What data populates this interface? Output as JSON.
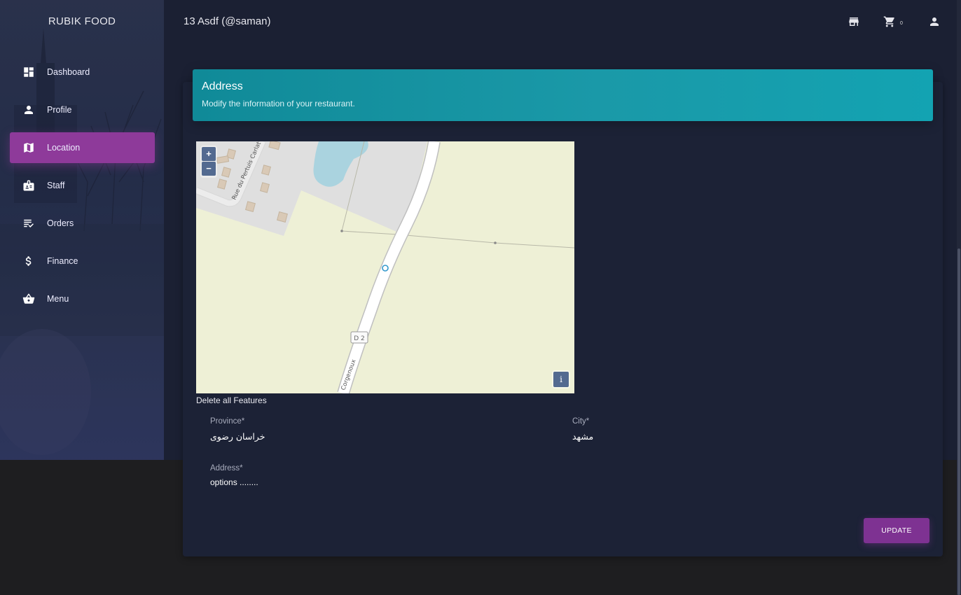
{
  "brand": "RUBIK FOOD",
  "topbar": {
    "title": "13 Asdf (@saman)",
    "cart_count": "0"
  },
  "sidebar": {
    "items": [
      {
        "label": "Dashboard",
        "icon": "dashboard-icon",
        "active": false
      },
      {
        "label": "Profile",
        "icon": "person-icon",
        "active": false
      },
      {
        "label": "Location",
        "icon": "map-icon",
        "active": true
      },
      {
        "label": "Staff",
        "icon": "badge-icon",
        "active": false
      },
      {
        "label": "Orders",
        "icon": "checklist-icon",
        "active": false
      },
      {
        "label": "Finance",
        "icon": "dollar-icon",
        "active": false
      },
      {
        "label": "Menu",
        "icon": "basket-icon",
        "active": false
      }
    ]
  },
  "card": {
    "title": "Address",
    "subtitle": "Modify the information of your restaurant."
  },
  "map": {
    "zoom_in": "+",
    "zoom_out": "−",
    "info": "i",
    "street_label_1": "Rue du Pertuis Carlat",
    "street_label_2": "Corgenoux",
    "road_shield": "D 2"
  },
  "delete_features": "Delete all Features",
  "form": {
    "province_label": "Province*",
    "province_value": "خراسان رضوی",
    "city_label": "City*",
    "city_value": "مشهد",
    "address_label": "Address*",
    "address_value": "options ........"
  },
  "update_button": "UPDATE",
  "colors": {
    "accent": "#8e3a9a",
    "header": "#13a3b2",
    "background": "#1b2033"
  }
}
